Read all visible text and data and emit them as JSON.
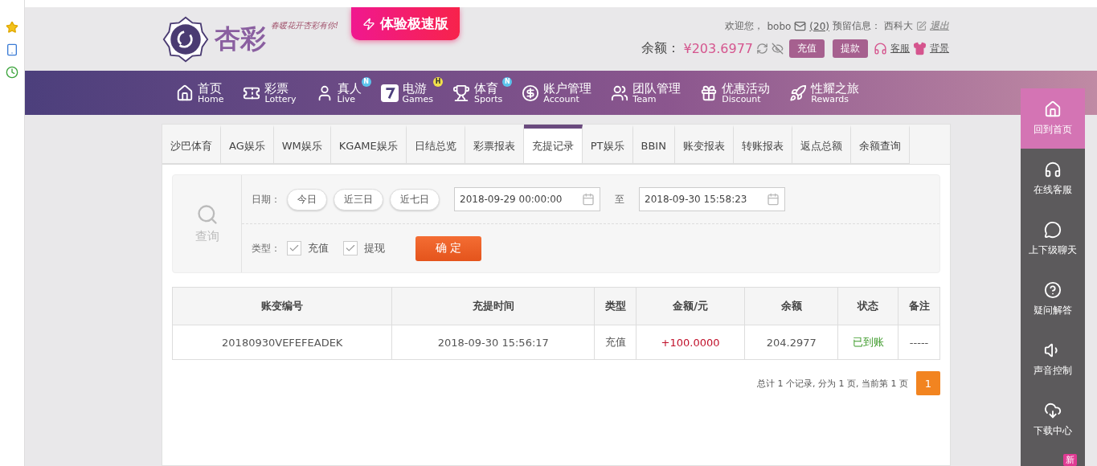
{
  "brand": {
    "name": "杏彩",
    "slogan": "春暖花开杏彩有你!",
    "promo": "体验极速版"
  },
  "user": {
    "welcome": "欢迎您，",
    "username": "bobo",
    "messages": "(20)",
    "reserved_label": "预留信息：",
    "reserved_value": "西科大",
    "logout": "退出",
    "balance_label": "余额：",
    "balance": "¥203.6977",
    "deposit": "充值",
    "withdraw": "提款",
    "service": "客服",
    "background": "背景"
  },
  "nav": [
    {
      "title": "首页",
      "subtitle": "Home",
      "kind": "home"
    },
    {
      "title": "彩票",
      "subtitle": "Lottery",
      "kind": "ticket"
    },
    {
      "title": "真人",
      "subtitle": "Live",
      "kind": "live",
      "badge": "N"
    },
    {
      "title": "电游",
      "subtitle": "Games",
      "kind": "seven",
      "badge": "H"
    },
    {
      "title": "体育",
      "subtitle": "Sports",
      "kind": "trophy",
      "badge": "N"
    },
    {
      "title": "账户管理",
      "subtitle": "Account",
      "kind": "coin"
    },
    {
      "title": "团队管理",
      "subtitle": "Team",
      "kind": "team"
    },
    {
      "title": "优惠活动",
      "subtitle": "Discount",
      "kind": "gift"
    },
    {
      "title": "性耀之旅",
      "subtitle": "Rewards",
      "kind": "rocket"
    }
  ],
  "tabs": [
    {
      "label": "沙巴体育",
      "selected": false
    },
    {
      "label": "AG娱乐",
      "selected": false
    },
    {
      "label": "WM娱乐",
      "selected": false
    },
    {
      "label": "KGAME娱乐",
      "selected": false
    },
    {
      "label": "日结总览",
      "selected": false
    },
    {
      "label": "彩票报表",
      "selected": false
    },
    {
      "label": "充提记录",
      "selected": true
    },
    {
      "label": "PT娱乐",
      "selected": false
    },
    {
      "label": "BBIN",
      "selected": false
    },
    {
      "label": "账变报表",
      "selected": false
    },
    {
      "label": "转账报表",
      "selected": false
    },
    {
      "label": "返点总额",
      "selected": false
    },
    {
      "label": "余额查询",
      "selected": false
    }
  ],
  "query": {
    "label": "查询",
    "date_label": "日期：",
    "quick_ranges": [
      "今日",
      "近三日",
      "近七日"
    ],
    "start": "2018-09-29 00:00:00",
    "to": "至",
    "end": "2018-09-30 15:58:23",
    "type_label": "类型：",
    "types": [
      {
        "label": "充值",
        "checked": true
      },
      {
        "label": "提现",
        "checked": true
      }
    ],
    "submit": "确 定"
  },
  "table": {
    "columns": [
      "账变编号",
      "充提时间",
      "类型",
      "金额/元",
      "余额",
      "状态",
      "备注"
    ],
    "rows": [
      [
        "20180930VEFEFEADEK",
        "2018-09-30 15:56:17",
        "充值",
        "+100.0000",
        "204.2977",
        "已到账",
        "-----"
      ]
    ]
  },
  "pagination": {
    "summary": "总计 1 个记录, 分为 1 页, 当前第 1 页",
    "pages": [
      {
        "label": "1",
        "selected": true
      }
    ]
  },
  "side_menu": [
    {
      "label": "回到首页",
      "kind": "home",
      "selected": true
    },
    {
      "label": "在线客服",
      "kind": "headset",
      "selected": false
    },
    {
      "label": "上下级聊天",
      "kind": "chat",
      "selected": false
    },
    {
      "label": "疑问解答",
      "kind": "question",
      "selected": false
    },
    {
      "label": "声音控制",
      "kind": "sound",
      "selected": false
    },
    {
      "label": "下载中心",
      "kind": "download",
      "selected": false
    }
  ],
  "side_badge": "新"
}
